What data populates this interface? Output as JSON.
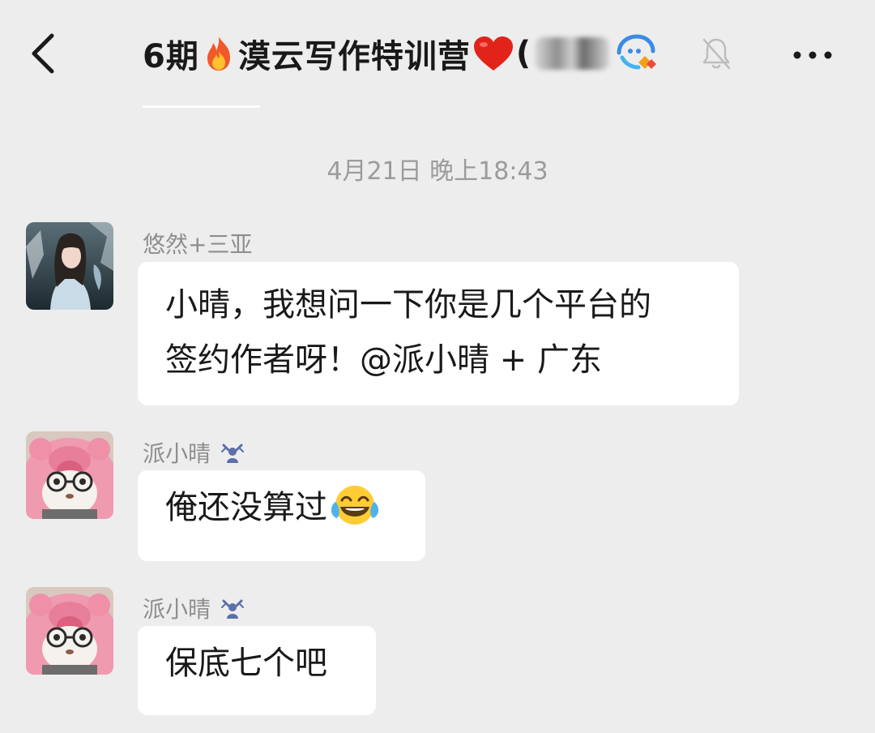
{
  "header": {
    "title_prefix": "6期",
    "title_main": "漠云写作特训营",
    "title_bracket": "("
  },
  "timestamp": "4月21日 晚上18:43",
  "messages": [
    {
      "sender": "悠然+三亚",
      "lines": [
        "小晴，我想问一下你是几个平台的",
        "签约作者呀！@派小晴 + 广东"
      ]
    },
    {
      "sender": "派小晴",
      "lines": [
        "俺还没算过"
      ],
      "emoji": "tears-of-joy-emoji"
    },
    {
      "sender": "派小晴",
      "lines": [
        "保底七个吧"
      ]
    }
  ],
  "icons": {
    "back": "chevron-left-icon",
    "fire": "fire-emoji",
    "heart": "red-heart-emoji",
    "group_badge": "group-chat-icon",
    "mute": "muted-bell-icon",
    "more": "more-dots-icon",
    "sender_badge": "member-badge-icon"
  },
  "colors": {
    "background": "#ededed",
    "bubble": "#ffffff",
    "text": "#191919",
    "secondary_text": "#9b9b9b"
  }
}
